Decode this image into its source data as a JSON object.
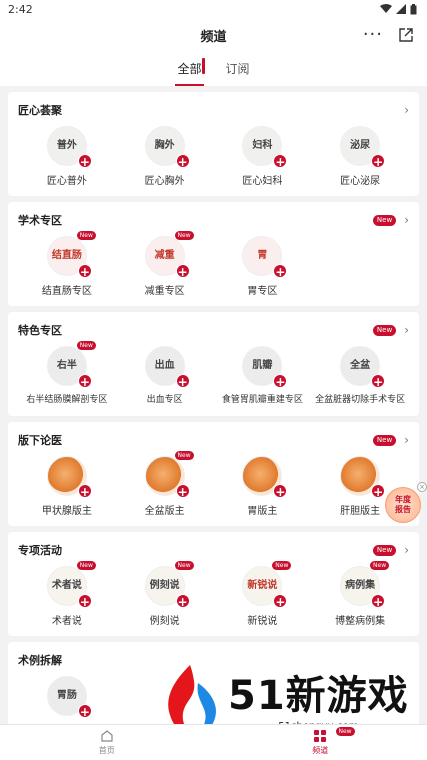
{
  "status_bar": {
    "time": "2:42"
  },
  "header": {
    "title": "频道"
  },
  "tabs": [
    {
      "label": "全部",
      "active": true
    },
    {
      "label": "订阅",
      "active": false
    }
  ],
  "sections": [
    {
      "title": "匠心荟聚",
      "new": false,
      "items": [
        {
          "label": "匠心普外",
          "icon": "calligraphy-icon",
          "glyph": "普外",
          "new": false
        },
        {
          "label": "匠心胸外",
          "icon": "calligraphy-icon",
          "glyph": "胸外",
          "new": false
        },
        {
          "label": "匠心妇科",
          "icon": "calligraphy-icon",
          "glyph": "妇科",
          "new": false
        },
        {
          "label": "匠心泌尿",
          "icon": "calligraphy-icon",
          "glyph": "泌尿",
          "new": false
        }
      ]
    },
    {
      "title": "学术专区",
      "new": true,
      "items": [
        {
          "label": "结直肠专区",
          "icon": "calligraphy-icon",
          "glyph": "结直肠",
          "new": true
        },
        {
          "label": "减重专区",
          "icon": "calligraphy-icon",
          "glyph": "减重",
          "new": true
        },
        {
          "label": "胃专区",
          "icon": "calligraphy-icon",
          "glyph": "胃",
          "new": false
        }
      ]
    },
    {
      "title": "特色专区",
      "new": true,
      "items": [
        {
          "label": "右半结肠膜解剖专区",
          "icon": "calligraphy-icon",
          "glyph": "右半",
          "new": true
        },
        {
          "label": "出血专区",
          "icon": "calligraphy-icon",
          "glyph": "出血",
          "new": false
        },
        {
          "label": "食管胃肌瓣重建专区",
          "icon": "calligraphy-icon",
          "glyph": "肌瓣",
          "new": false
        },
        {
          "label": "全盆脏器切除手术专区",
          "icon": "calligraphy-icon",
          "glyph": "全盆",
          "new": false
        }
      ]
    },
    {
      "title": "版下论医",
      "new": true,
      "items": [
        {
          "label": "甲状腺版主",
          "icon": "organ-icon",
          "glyph": "",
          "new": false
        },
        {
          "label": "全盆版主",
          "icon": "organ-icon",
          "glyph": "",
          "new": true
        },
        {
          "label": "胃版主",
          "icon": "organ-icon",
          "glyph": "",
          "new": false
        },
        {
          "label": "肝胆版主",
          "icon": "organ-icon",
          "glyph": "",
          "new": false
        }
      ]
    },
    {
      "title": "专项活动",
      "new": true,
      "items": [
        {
          "label": "术者说",
          "icon": "calligraphy-icon",
          "glyph": "术者说",
          "new": true
        },
        {
          "label": "例刻说",
          "icon": "calligraphy-icon",
          "glyph": "例刻说",
          "new": true
        },
        {
          "label": "新锐说",
          "icon": "calligraphy-icon",
          "glyph": "新锐说",
          "new": true
        },
        {
          "label": "博整病例集",
          "icon": "calligraphy-icon",
          "glyph": "病例集",
          "new": true
        }
      ]
    },
    {
      "title": "术例拆解",
      "new": false,
      "items": [
        {
          "label": "胃肠",
          "icon": "calligraphy-icon",
          "glyph": "胃肠",
          "new": false
        }
      ]
    }
  ],
  "floating_badge": {
    "line1": "年度",
    "line2": "报告"
  },
  "bottom_nav": [
    {
      "label": "首页",
      "active": false
    },
    {
      "label": "频道",
      "active": true,
      "new": "New"
    }
  ],
  "new_badge": "New",
  "watermark": {
    "brand": "51新游戏",
    "url": "51chengyu.com"
  },
  "colors": {
    "accent": "#c8102e",
    "background": "#f2f2f2"
  }
}
